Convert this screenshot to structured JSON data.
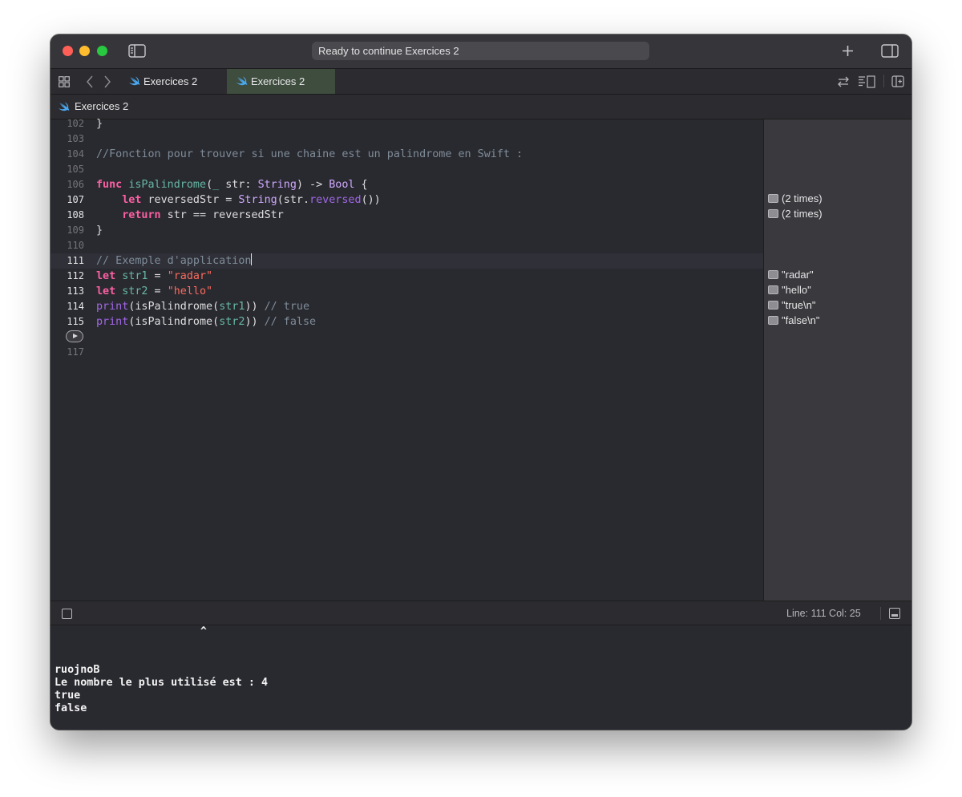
{
  "titlebar": {
    "activity": "Ready to continue Exercices 2"
  },
  "tabs": [
    {
      "label": "Exercices 2"
    },
    {
      "label": "Exercices 2"
    }
  ],
  "jumpbar": {
    "label": "Exercices 2"
  },
  "lines": [
    "102",
    "103",
    "104",
    "105",
    "106",
    "107",
    "108",
    "109",
    "110",
    "111",
    "112",
    "113",
    "114",
    "115",
    "117"
  ],
  "code": {
    "l102": "}",
    "l104": "//Fonction pour trouver si une chaine est un palindrome en Swift :",
    "l106": {
      "kw": "func",
      "name": "isPalindrome",
      "rest1": "(",
      "under": "_",
      "rest2": " str: ",
      "type1": "String",
      "rest3": ") -> ",
      "type2": "Bool",
      "rest4": " {"
    },
    "l107": {
      "indent": "    ",
      "kw": "let",
      "rest1": " reversedStr = ",
      "type": "String",
      "rest2": "(str.",
      "method": "reversed",
      "rest3": "())"
    },
    "l108": {
      "indent": "    ",
      "kw": "return",
      "rest": " str == reversedStr"
    },
    "l109": "}",
    "l111": "// Exemple d'application",
    "l112": {
      "kw": "let",
      "var": "str1",
      "eq": " = ",
      "str": "\"radar\""
    },
    "l113": {
      "kw": "let",
      "var": "str2",
      "eq": " = ",
      "str": "\"hello\""
    },
    "l114": {
      "fn": "print",
      "rest1": "(isPalindrome(",
      "arg": "str1",
      "rest2": ")) ",
      "comment": "// true"
    },
    "l115": {
      "fn": "print",
      "rest1": "(isPalindrome(",
      "arg": "str2",
      "rest2": ")) ",
      "comment": "// false"
    }
  },
  "results": [
    "(2 times)",
    "(2 times)",
    "\"radar\"",
    "\"hello\"",
    "\"true\\n\"",
    "\"false\\n\""
  ],
  "status": {
    "position": "Line: 111  Col: 25"
  },
  "console": {
    "caret": "^",
    "lines": [
      "ruojnoB",
      "Le nombre le plus utilisé est : 4",
      "true",
      "false"
    ]
  },
  "colors": {
    "keyword": "#fc5fa3",
    "function": "#67b7a4",
    "type": "#d0a8ff",
    "comment": "#7f8c98",
    "string": "#fc6a5d",
    "activeTab": "#3f4d3e"
  },
  "icons": [
    "sidebar-toggle-icon",
    "add-icon",
    "inspector-icon",
    "grid-icon",
    "back-icon",
    "forward-icon",
    "swift-icon",
    "swap-icon",
    "minimap-icon",
    "split-editor-icon",
    "run-icon",
    "result-quicklook-icon",
    "console-toggle-icon"
  ]
}
